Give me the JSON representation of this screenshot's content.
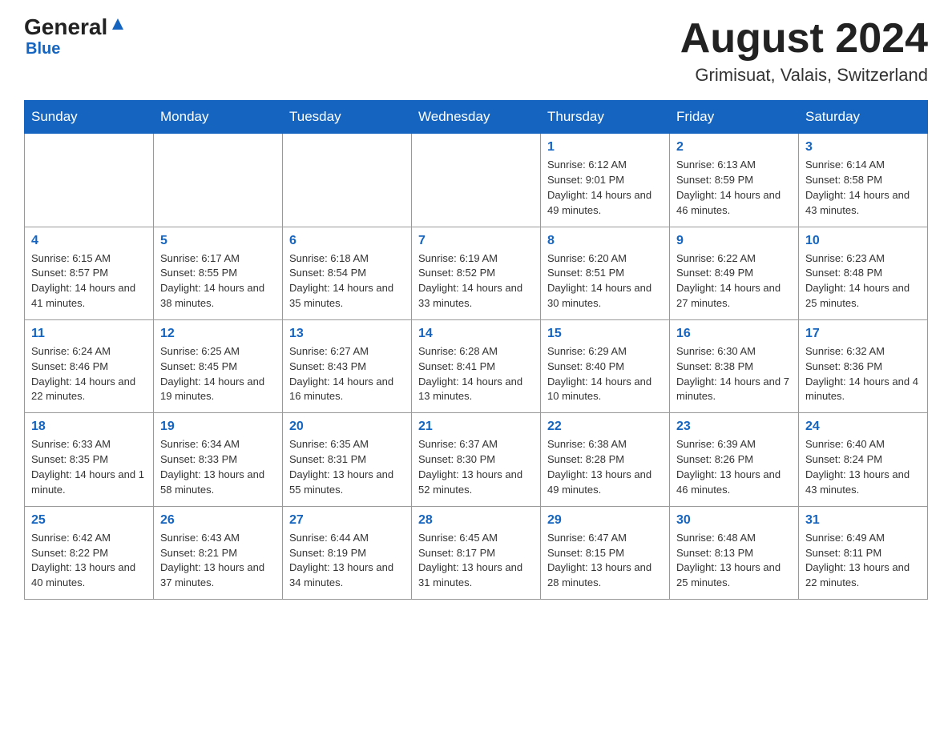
{
  "header": {
    "logo_general": "General",
    "logo_blue": "Blue",
    "month_title": "August 2024",
    "location": "Grimisuat, Valais, Switzerland"
  },
  "calendar": {
    "days_of_week": [
      "Sunday",
      "Monday",
      "Tuesday",
      "Wednesday",
      "Thursday",
      "Friday",
      "Saturday"
    ],
    "weeks": [
      [
        {
          "day": "",
          "info": ""
        },
        {
          "day": "",
          "info": ""
        },
        {
          "day": "",
          "info": ""
        },
        {
          "day": "",
          "info": ""
        },
        {
          "day": "1",
          "info": "Sunrise: 6:12 AM\nSunset: 9:01 PM\nDaylight: 14 hours and 49 minutes."
        },
        {
          "day": "2",
          "info": "Sunrise: 6:13 AM\nSunset: 8:59 PM\nDaylight: 14 hours and 46 minutes."
        },
        {
          "day": "3",
          "info": "Sunrise: 6:14 AM\nSunset: 8:58 PM\nDaylight: 14 hours and 43 minutes."
        }
      ],
      [
        {
          "day": "4",
          "info": "Sunrise: 6:15 AM\nSunset: 8:57 PM\nDaylight: 14 hours and 41 minutes."
        },
        {
          "day": "5",
          "info": "Sunrise: 6:17 AM\nSunset: 8:55 PM\nDaylight: 14 hours and 38 minutes."
        },
        {
          "day": "6",
          "info": "Sunrise: 6:18 AM\nSunset: 8:54 PM\nDaylight: 14 hours and 35 minutes."
        },
        {
          "day": "7",
          "info": "Sunrise: 6:19 AM\nSunset: 8:52 PM\nDaylight: 14 hours and 33 minutes."
        },
        {
          "day": "8",
          "info": "Sunrise: 6:20 AM\nSunset: 8:51 PM\nDaylight: 14 hours and 30 minutes."
        },
        {
          "day": "9",
          "info": "Sunrise: 6:22 AM\nSunset: 8:49 PM\nDaylight: 14 hours and 27 minutes."
        },
        {
          "day": "10",
          "info": "Sunrise: 6:23 AM\nSunset: 8:48 PM\nDaylight: 14 hours and 25 minutes."
        }
      ],
      [
        {
          "day": "11",
          "info": "Sunrise: 6:24 AM\nSunset: 8:46 PM\nDaylight: 14 hours and 22 minutes."
        },
        {
          "day": "12",
          "info": "Sunrise: 6:25 AM\nSunset: 8:45 PM\nDaylight: 14 hours and 19 minutes."
        },
        {
          "day": "13",
          "info": "Sunrise: 6:27 AM\nSunset: 8:43 PM\nDaylight: 14 hours and 16 minutes."
        },
        {
          "day": "14",
          "info": "Sunrise: 6:28 AM\nSunset: 8:41 PM\nDaylight: 14 hours and 13 minutes."
        },
        {
          "day": "15",
          "info": "Sunrise: 6:29 AM\nSunset: 8:40 PM\nDaylight: 14 hours and 10 minutes."
        },
        {
          "day": "16",
          "info": "Sunrise: 6:30 AM\nSunset: 8:38 PM\nDaylight: 14 hours and 7 minutes."
        },
        {
          "day": "17",
          "info": "Sunrise: 6:32 AM\nSunset: 8:36 PM\nDaylight: 14 hours and 4 minutes."
        }
      ],
      [
        {
          "day": "18",
          "info": "Sunrise: 6:33 AM\nSunset: 8:35 PM\nDaylight: 14 hours and 1 minute."
        },
        {
          "day": "19",
          "info": "Sunrise: 6:34 AM\nSunset: 8:33 PM\nDaylight: 13 hours and 58 minutes."
        },
        {
          "day": "20",
          "info": "Sunrise: 6:35 AM\nSunset: 8:31 PM\nDaylight: 13 hours and 55 minutes."
        },
        {
          "day": "21",
          "info": "Sunrise: 6:37 AM\nSunset: 8:30 PM\nDaylight: 13 hours and 52 minutes."
        },
        {
          "day": "22",
          "info": "Sunrise: 6:38 AM\nSunset: 8:28 PM\nDaylight: 13 hours and 49 minutes."
        },
        {
          "day": "23",
          "info": "Sunrise: 6:39 AM\nSunset: 8:26 PM\nDaylight: 13 hours and 46 minutes."
        },
        {
          "day": "24",
          "info": "Sunrise: 6:40 AM\nSunset: 8:24 PM\nDaylight: 13 hours and 43 minutes."
        }
      ],
      [
        {
          "day": "25",
          "info": "Sunrise: 6:42 AM\nSunset: 8:22 PM\nDaylight: 13 hours and 40 minutes."
        },
        {
          "day": "26",
          "info": "Sunrise: 6:43 AM\nSunset: 8:21 PM\nDaylight: 13 hours and 37 minutes."
        },
        {
          "day": "27",
          "info": "Sunrise: 6:44 AM\nSunset: 8:19 PM\nDaylight: 13 hours and 34 minutes."
        },
        {
          "day": "28",
          "info": "Sunrise: 6:45 AM\nSunset: 8:17 PM\nDaylight: 13 hours and 31 minutes."
        },
        {
          "day": "29",
          "info": "Sunrise: 6:47 AM\nSunset: 8:15 PM\nDaylight: 13 hours and 28 minutes."
        },
        {
          "day": "30",
          "info": "Sunrise: 6:48 AM\nSunset: 8:13 PM\nDaylight: 13 hours and 25 minutes."
        },
        {
          "day": "31",
          "info": "Sunrise: 6:49 AM\nSunset: 8:11 PM\nDaylight: 13 hours and 22 minutes."
        }
      ]
    ]
  }
}
